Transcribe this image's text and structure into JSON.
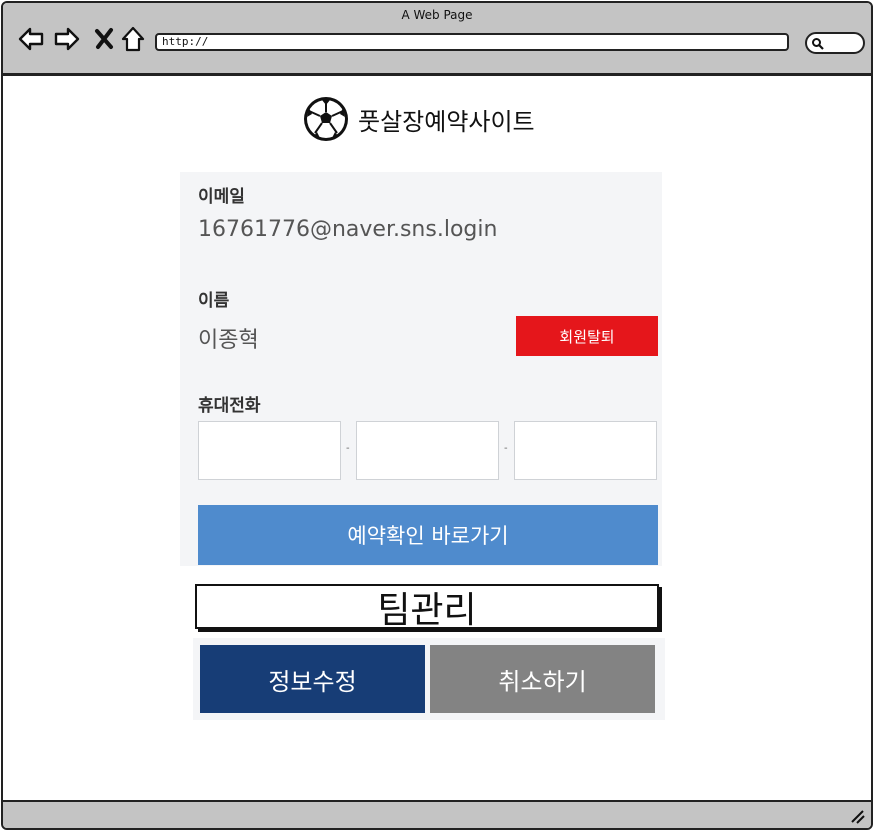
{
  "browser": {
    "window_title": "A Web Page",
    "url": "http://",
    "icons": [
      "back-arrow-icon",
      "forward-arrow-icon",
      "close-x-icon",
      "home-icon",
      "search-icon",
      "resize-grip-icon"
    ]
  },
  "header": {
    "logo_icon": "soccer-ball-icon",
    "site_title": "풋살장예약사이트"
  },
  "profile": {
    "email_label": "이메일",
    "email_value": "16761776@naver.sns.login",
    "name_label": "이름",
    "name_value": "이종혁",
    "withdraw_label": "회원탈퇴",
    "phone_label": "휴대전화",
    "phone_parts": [
      "",
      "",
      ""
    ],
    "phone_separator": "-",
    "reservation_link_label": "예약확인 바로가기"
  },
  "team": {
    "label": "팀관리"
  },
  "actions": {
    "edit_label": "정보수정",
    "cancel_label": "취소하기"
  },
  "colors": {
    "withdraw": "#e5161b",
    "reservation": "#4f8bcd",
    "edit": "#173d76",
    "cancel": "#838383",
    "panel_bg": "#f4f5f7"
  }
}
